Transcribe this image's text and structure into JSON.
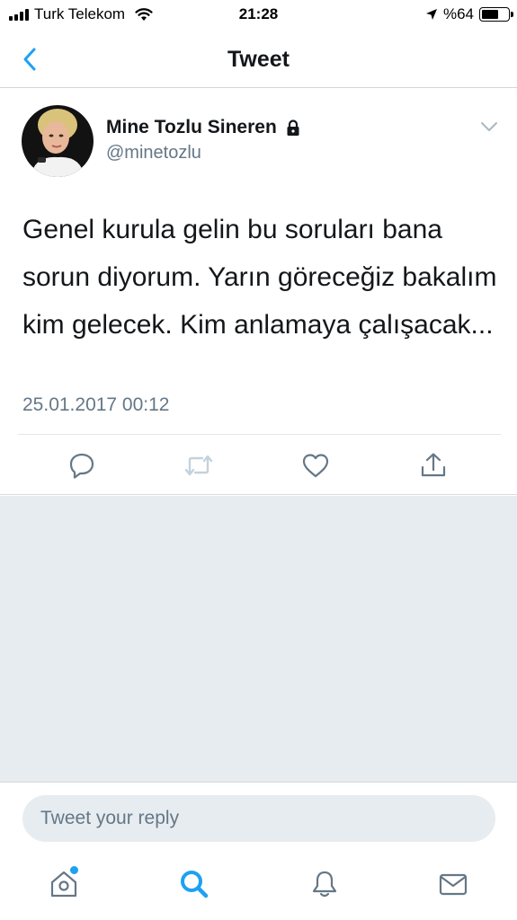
{
  "status_bar": {
    "carrier": "Turk Telekom",
    "time": "21:28",
    "battery_percent": "%64",
    "battery_level": 0.64
  },
  "nav": {
    "title": "Tweet"
  },
  "tweet": {
    "author_name": "Mine Tozlu Sineren",
    "author_handle": "@minetozlu",
    "text": "Genel kurula gelin bu soruları bana sorun diyorum. Yarın göreceğiz bakalım kim gelecek. Kim anlamaya çalışacak...",
    "timestamp": "25.01.2017 00:12"
  },
  "reply": {
    "placeholder": "Tweet your reply"
  },
  "icons": {
    "back": "chevron-left-icon",
    "lock": "lock-icon",
    "caret": "chevron-down-icon",
    "reply": "reply-icon",
    "retweet": "retweet-icon",
    "like": "heart-icon",
    "share": "share-icon",
    "home": "home-icon",
    "search": "search-icon",
    "notifications": "bell-icon",
    "messages": "envelope-icon"
  },
  "colors": {
    "accent": "#1da1f2",
    "text": "#14171a",
    "secondary_text": "#657786",
    "background_gray": "#e6ecf0",
    "retweet_disabled": "#c4d2dc"
  }
}
